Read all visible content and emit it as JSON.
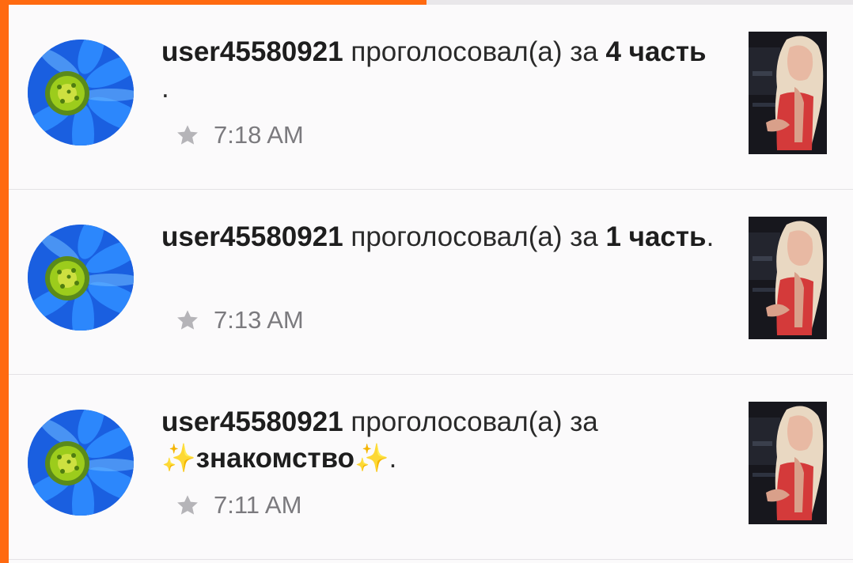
{
  "progress": {
    "fraction": 0.5
  },
  "colors": {
    "accent": "#ff6a10",
    "separator": "#e4e2e5",
    "time": "#7b7a7e"
  },
  "notifications": [
    {
      "username": "user45580921",
      "verb": "проголосовал(а) за",
      "story": "4 часть",
      "suffix": " .",
      "time": "7:18 AM",
      "icon": "star-icon",
      "avatar": "blue-flower-avatar",
      "thumbnail": "story-cover"
    },
    {
      "username": "user45580921",
      "verb": "проголосовал(а) за",
      "story": "1 часть",
      "suffix": ".",
      "time": "7:13 AM",
      "icon": "star-icon",
      "avatar": "blue-flower-avatar",
      "thumbnail": "story-cover"
    },
    {
      "username": "user45580921",
      "verb": "проголосовал(а) за",
      "story": "✨знакомство✨",
      "suffix": ".",
      "time": "7:11 AM",
      "icon": "star-icon",
      "avatar": "blue-flower-avatar",
      "thumbnail": "story-cover"
    }
  ]
}
